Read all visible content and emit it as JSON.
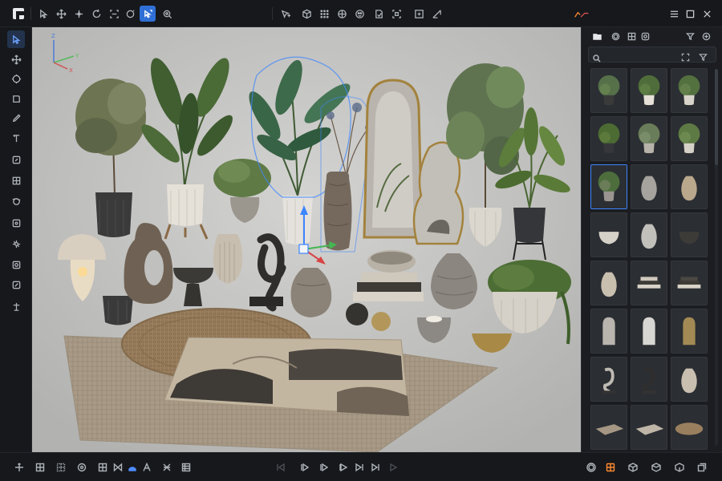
{
  "app": {
    "brand_color": "#2f6fd6",
    "accent_color": "#ff8a30",
    "selection_color": "#3d86ff"
  },
  "topbar": {
    "tools": [
      {
        "name": "select-arrow-icon",
        "active": false
      },
      {
        "name": "move-icon",
        "active": false
      },
      {
        "name": "translate-icon",
        "active": false
      },
      {
        "name": "rotate-icon",
        "active": false
      },
      {
        "name": "scale-icon",
        "active": false
      },
      {
        "name": "rotate-circle-icon",
        "active": false
      },
      {
        "name": "pointer-select-icon",
        "active": true
      },
      {
        "name": "zoom-target-icon",
        "active": false
      }
    ],
    "center_tools": [
      "cursor-plus-icon",
      "cube-icon",
      "grid-icon",
      "globe-icon",
      "sphere-icon",
      "frame-icon",
      "focus-icon",
      "camera-frame-icon",
      "pen-corner-icon"
    ],
    "right_tools": [
      "graph-icon"
    ],
    "window_controls": [
      "menu-icon",
      "maximize-icon",
      "close-icon"
    ]
  },
  "left_tools": [
    "select-icon",
    "move-icon",
    "rotate-icon",
    "brush-icon",
    "pencil-icon",
    "text-tool-icon",
    "layer-icon",
    "grid-box-icon",
    "orbit-icon",
    "focus-box-icon",
    "cluster-icon",
    "zoom-icon",
    "frame-icon",
    "anchor-icon"
  ],
  "viewport": {
    "axes": {
      "z": "Z",
      "y": "Y",
      "x": "X"
    },
    "background": "#c6c6c4"
  },
  "asset_panel": {
    "tabs": [
      "folder-icon",
      "gear-icon",
      "grid-icon",
      "material-icon"
    ],
    "actions": [
      "filter-icon",
      "add-icon"
    ],
    "search": {
      "placeholder": "",
      "value": ""
    },
    "tiles": [
      {
        "name": "olive-tree-pot",
        "selected": false
      },
      {
        "name": "banana-plant-pot",
        "selected": false
      },
      {
        "name": "fern-pot",
        "selected": false
      },
      {
        "name": "palm-dark-pot",
        "selected": false
      },
      {
        "name": "fern-white-pot",
        "selected": false
      },
      {
        "name": "small-fern-pot",
        "selected": false
      },
      {
        "name": "plant-group",
        "selected": true
      },
      {
        "name": "glazed-vase",
        "selected": false
      },
      {
        "name": "stone-vase",
        "selected": false
      },
      {
        "name": "bowl-white",
        "selected": false
      },
      {
        "name": "ribbed-vase",
        "selected": false
      },
      {
        "name": "dark-bowl",
        "selected": false
      },
      {
        "name": "ribbed-jar",
        "selected": false
      },
      {
        "name": "book-stack-bowl",
        "selected": false
      },
      {
        "name": "book-stack-dark",
        "selected": false
      },
      {
        "name": "arch-mirror",
        "selected": false
      },
      {
        "name": "arch-stone",
        "selected": false
      },
      {
        "name": "arch-mirror-gold",
        "selected": false
      },
      {
        "name": "knot-sculpture",
        "selected": false
      },
      {
        "name": "twig-vase",
        "selected": false
      },
      {
        "name": "loop-vase",
        "selected": false
      },
      {
        "name": "rug-rectangle",
        "selected": false
      },
      {
        "name": "rug-square",
        "selected": false
      },
      {
        "name": "rug-round",
        "selected": false
      }
    ]
  },
  "bottombar": {
    "left": [
      "orbit-icon",
      "grid-icon",
      "dotted-grid-icon",
      "target-icon",
      "table-icon",
      "mirror-icon",
      "water-icon",
      "a-icon",
      "snap-icon",
      "list-icon"
    ],
    "playback": [
      "skip-start-icon",
      "prev-frame-icon",
      "play-icon",
      "next-frame-icon",
      "skip-end-icon",
      "play-outline-icon"
    ],
    "right": [
      "sun-icon",
      "grid-active-icon",
      "box-icon",
      "box2-icon",
      "box3-icon",
      "copy-icon"
    ]
  }
}
